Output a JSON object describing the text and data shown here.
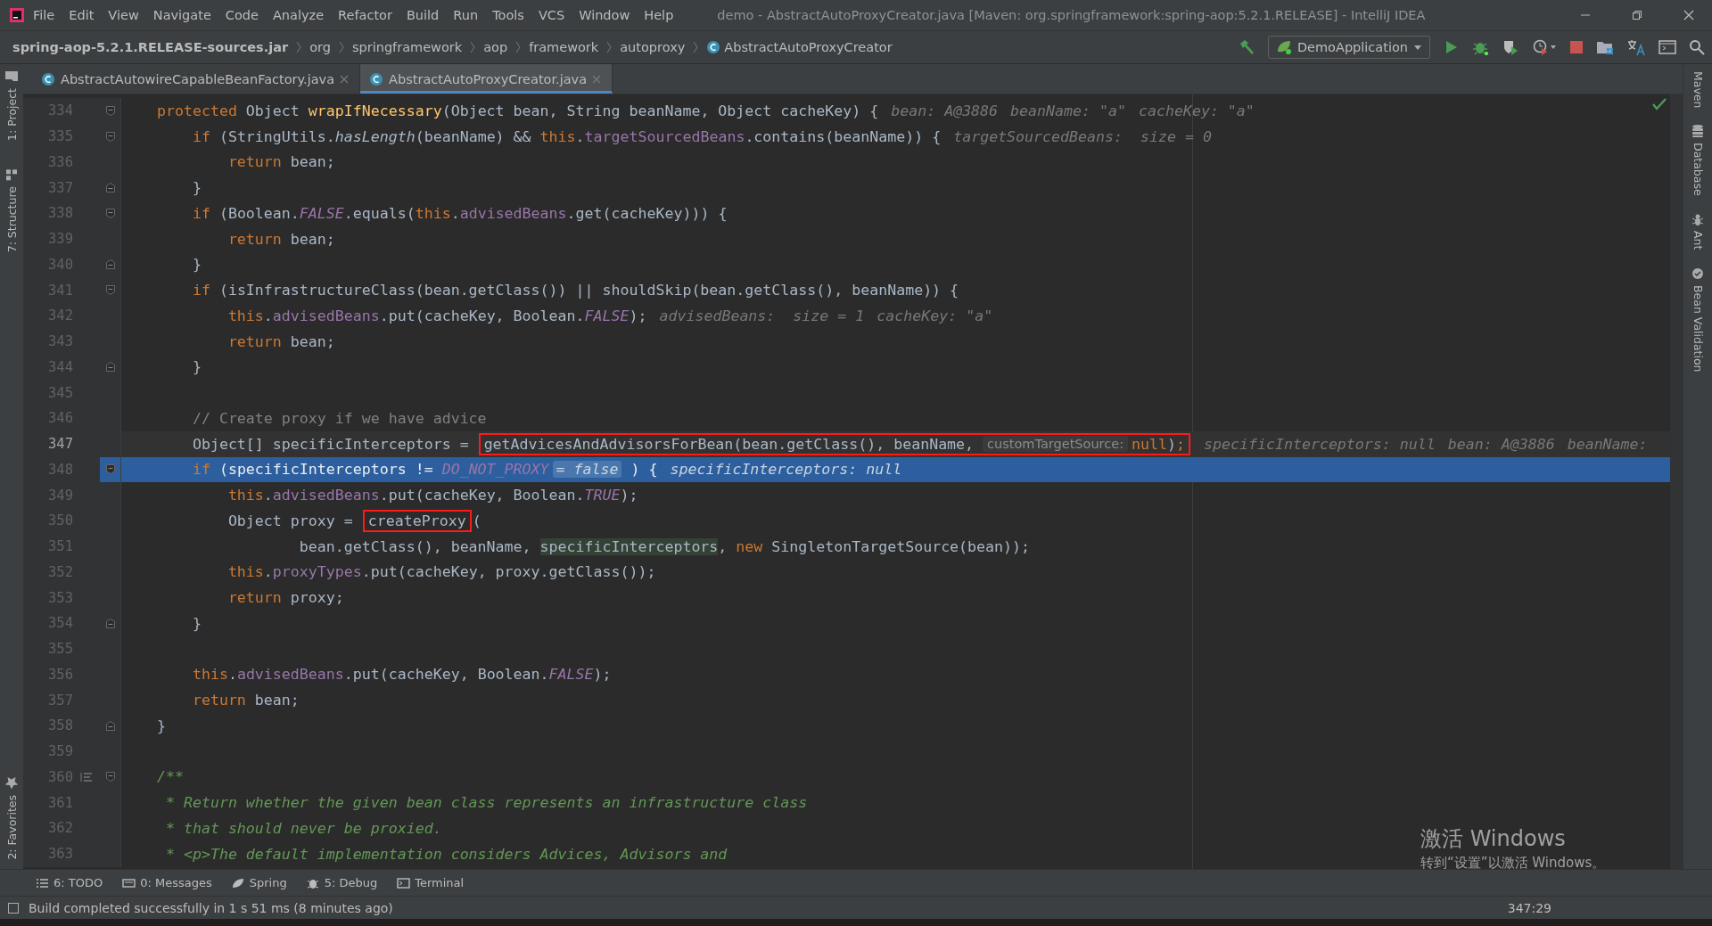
{
  "window": {
    "title": "demo - AbstractAutoProxyCreator.java [Maven: org.springframework:spring-aop:5.2.1.RELEASE] - IntelliJ IDEA"
  },
  "menu": [
    "File",
    "Edit",
    "View",
    "Navigate",
    "Code",
    "Analyze",
    "Refactor",
    "Build",
    "Run",
    "Tools",
    "VCS",
    "Window",
    "Help"
  ],
  "breadcrumbs": [
    {
      "label": "spring-aop-5.2.1.RELEASE-sources.jar",
      "kind": "jar"
    },
    {
      "label": "org",
      "kind": "package"
    },
    {
      "label": "springframework",
      "kind": "package"
    },
    {
      "label": "aop",
      "kind": "package"
    },
    {
      "label": "framework",
      "kind": "package"
    },
    {
      "label": "autoproxy",
      "kind": "package"
    },
    {
      "label": "AbstractAutoProxyCreator",
      "kind": "class"
    }
  ],
  "run_config": {
    "label": "DemoApplication"
  },
  "tabs": [
    {
      "label": "AbstractAutowireCapableBeanFactory.java",
      "selected": false
    },
    {
      "label": "AbstractAutoProxyCreator.java",
      "selected": true
    }
  ],
  "left_tools": [
    {
      "label": "1: Project",
      "kind": "folder"
    },
    {
      "label": "7: Structure",
      "kind": "structure"
    },
    {
      "label": "2: Favorites",
      "kind": "star"
    }
  ],
  "right_tools": [
    {
      "label": "Maven",
      "kind": "maven"
    },
    {
      "label": "Database",
      "kind": "database"
    },
    {
      "label": "Ant",
      "kind": "ant"
    },
    {
      "label": "Bean Validation",
      "kind": "bean"
    }
  ],
  "lines": [
    {
      "number": "334",
      "caret": false,
      "execution": false,
      "fold_start": true,
      "fold_end": false,
      "doc_toggle": false,
      "segments": [
        {
          "kind": "code",
          "parts": [
            {
              "kind": "keyword",
              "text": "    protected"
            },
            {
              "kind": "plain",
              "text": " Object "
            },
            {
              "kind": "decl",
              "text": "wrapIfNecessary"
            },
            {
              "kind": "plain",
              "text": "(Object bean, String beanName, Object cacheKey) {"
            }
          ]
        },
        {
          "kind": "hint",
          "text": "bean: A@3886"
        },
        {
          "kind": "hint",
          "text": "beanName: \"a\""
        },
        {
          "kind": "hint",
          "text": "cacheKey: \"a\""
        }
      ]
    },
    {
      "number": "335",
      "caret": false,
      "execution": false,
      "fold_start": true,
      "fold_end": false,
      "doc_toggle": false,
      "segments": [
        {
          "kind": "code",
          "parts": [
            {
              "kind": "keyword",
              "text": "        if"
            },
            {
              "kind": "plain",
              "text": " (StringUtils."
            },
            {
              "kind": "static-method",
              "text": "hasLength"
            },
            {
              "kind": "plain",
              "text": "(beanName) && "
            },
            {
              "kind": "keyword",
              "text": "this"
            },
            {
              "kind": "plain",
              "text": "."
            },
            {
              "kind": "field",
              "text": "targetSourcedBeans"
            },
            {
              "kind": "plain",
              "text": ".contains(beanName)) {"
            }
          ]
        },
        {
          "kind": "hint",
          "text": "targetSourcedBeans:  size = 0"
        }
      ]
    },
    {
      "number": "336",
      "caret": false,
      "execution": false,
      "fold_start": false,
      "fold_end": false,
      "doc_toggle": false,
      "segments": [
        {
          "kind": "code",
          "parts": [
            {
              "kind": "keyword",
              "text": "            return"
            },
            {
              "kind": "plain",
              "text": " bean;"
            }
          ]
        }
      ]
    },
    {
      "number": "337",
      "caret": false,
      "execution": false,
      "fold_start": false,
      "fold_end": true,
      "doc_toggle": false,
      "segments": [
        {
          "kind": "code",
          "parts": [
            {
              "kind": "plain",
              "text": "        }"
            }
          ]
        }
      ]
    },
    {
      "number": "338",
      "caret": false,
      "execution": false,
      "fold_start": true,
      "fold_end": false,
      "doc_toggle": false,
      "segments": [
        {
          "kind": "code",
          "parts": [
            {
              "kind": "keyword",
              "text": "        if"
            },
            {
              "kind": "plain",
              "text": " (Boolean."
            },
            {
              "kind": "static-field",
              "text": "FALSE"
            },
            {
              "kind": "plain",
              "text": ".equals("
            },
            {
              "kind": "keyword",
              "text": "this"
            },
            {
              "kind": "plain",
              "text": "."
            },
            {
              "kind": "field",
              "text": "advisedBeans"
            },
            {
              "kind": "plain",
              "text": ".get(cacheKey))) {"
            }
          ]
        }
      ]
    },
    {
      "number": "339",
      "caret": false,
      "execution": false,
      "fold_start": false,
      "fold_end": false,
      "doc_toggle": false,
      "segments": [
        {
          "kind": "code",
          "parts": [
            {
              "kind": "keyword",
              "text": "            return"
            },
            {
              "kind": "plain",
              "text": " bean;"
            }
          ]
        }
      ]
    },
    {
      "number": "340",
      "caret": false,
      "execution": false,
      "fold_start": false,
      "fold_end": true,
      "doc_toggle": false,
      "segments": [
        {
          "kind": "code",
          "parts": [
            {
              "kind": "plain",
              "text": "        }"
            }
          ]
        }
      ]
    },
    {
      "number": "341",
      "caret": false,
      "execution": false,
      "fold_start": true,
      "fold_end": false,
      "doc_toggle": false,
      "segments": [
        {
          "kind": "code",
          "parts": [
            {
              "kind": "keyword",
              "text": "        if"
            },
            {
              "kind": "plain",
              "text": " (isInfrastructureClass(bean.getClass()) || shouldSkip(bean.getClass(), beanName)) {"
            }
          ]
        }
      ]
    },
    {
      "number": "342",
      "caret": false,
      "execution": false,
      "fold_start": false,
      "fold_end": false,
      "doc_toggle": false,
      "segments": [
        {
          "kind": "code",
          "parts": [
            {
              "kind": "keyword",
              "text": "            this"
            },
            {
              "kind": "plain",
              "text": "."
            },
            {
              "kind": "field",
              "text": "advisedBeans"
            },
            {
              "kind": "plain",
              "text": ".put(cacheKey, Boolean."
            },
            {
              "kind": "static-field",
              "text": "FALSE"
            },
            {
              "kind": "plain",
              "text": ");"
            }
          ]
        },
        {
          "kind": "hint",
          "text": "advisedBeans:  size = 1"
        },
        {
          "kind": "hint",
          "text": "cacheKey: \"a\""
        }
      ]
    },
    {
      "number": "343",
      "caret": false,
      "execution": false,
      "fold_start": false,
      "fold_end": false,
      "doc_toggle": false,
      "segments": [
        {
          "kind": "code",
          "parts": [
            {
              "kind": "keyword",
              "text": "            return"
            },
            {
              "kind": "plain",
              "text": " bean;"
            }
          ]
        }
      ]
    },
    {
      "number": "344",
      "caret": false,
      "execution": false,
      "fold_start": false,
      "fold_end": true,
      "doc_toggle": false,
      "segments": [
        {
          "kind": "code",
          "parts": [
            {
              "kind": "plain",
              "text": "        }"
            }
          ]
        }
      ]
    },
    {
      "number": "345",
      "caret": false,
      "execution": false,
      "fold_start": false,
      "fold_end": false,
      "doc_toggle": false
    },
    {
      "number": "346",
      "caret": false,
      "execution": false,
      "fold_start": false,
      "fold_end": false,
      "doc_toggle": false,
      "segments": [
        {
          "kind": "code",
          "parts": [
            {
              "kind": "comment",
              "text": "        // Create proxy if we have advice"
            }
          ]
        }
      ]
    },
    {
      "number": "347",
      "caret": true,
      "execution": false,
      "fold_start": false,
      "fold_end": false,
      "doc_toggle": false,
      "segments": [
        {
          "kind": "code",
          "parts": [
            {
              "kind": "plain",
              "text": "        Object[] specificInterceptors = "
            }
          ]
        },
        {
          "kind": "boxed",
          "segments": [
            {
              "kind": "code",
              "parts": [
                {
                  "kind": "plain",
                  "text": "getAdvicesAndAdvisorsForBean(bean.getClass(), beanName, "
                }
              ]
            },
            {
              "kind": "param-hint",
              "text": "customTargetSource:"
            },
            {
              "kind": "code",
              "parts": [
                {
                  "kind": "keyword",
                  "text": "null"
                },
                {
                  "kind": "plain",
                  "text": ")"
                },
                {
                  "kind": "keyword",
                  "text": ";"
                }
              ]
            }
          ]
        },
        {
          "kind": "hint",
          "text": "specificInterceptors: null"
        },
        {
          "kind": "hint",
          "text": "bean: A@3886"
        },
        {
          "kind": "hint",
          "text": "beanName:"
        }
      ]
    },
    {
      "number": "348",
      "caret": false,
      "execution": true,
      "fold_start": true,
      "fold_end": false,
      "doc_toggle": false,
      "segments": [
        {
          "kind": "code",
          "parts": [
            {
              "kind": "keyword",
              "text": "        if"
            },
            {
              "kind": "plain",
              "text": " (specificInterceptors != "
            },
            {
              "kind": "static-field",
              "text": "DO_NOT_PROXY"
            }
          ]
        },
        {
          "kind": "value-hint",
          "text": "= false"
        },
        {
          "kind": "code",
          "parts": [
            {
              "kind": "plain",
              "text": " ) {"
            }
          ]
        },
        {
          "kind": "hint",
          "text": "specificInterceptors: null"
        }
      ]
    },
    {
      "number": "349",
      "caret": false,
      "execution": false,
      "fold_start": false,
      "fold_end": false,
      "doc_toggle": false,
      "segments": [
        {
          "kind": "code",
          "parts": [
            {
              "kind": "keyword",
              "text": "            this"
            },
            {
              "kind": "plain",
              "text": "."
            },
            {
              "kind": "field",
              "text": "advisedBeans"
            },
            {
              "kind": "plain",
              "text": ".put(cacheKey, Boolean."
            },
            {
              "kind": "static-field",
              "text": "TRUE"
            },
            {
              "kind": "plain",
              "text": ");"
            }
          ]
        }
      ]
    },
    {
      "number": "350",
      "caret": false,
      "execution": false,
      "fold_start": false,
      "fold_end": false,
      "doc_toggle": false,
      "segments": [
        {
          "kind": "code",
          "parts": [
            {
              "kind": "plain",
              "text": "            Object proxy = "
            }
          ]
        },
        {
          "kind": "boxed",
          "segments": [
            {
              "kind": "code",
              "parts": [
                {
                  "kind": "plain",
                  "text": "createProxy"
                }
              ]
            }
          ]
        },
        {
          "kind": "code",
          "parts": [
            {
              "kind": "plain",
              "text": "("
            }
          ]
        }
      ]
    },
    {
      "number": "351",
      "caret": false,
      "execution": false,
      "fold_start": false,
      "fold_end": false,
      "doc_toggle": false,
      "segments": [
        {
          "kind": "code",
          "parts": [
            {
              "kind": "plain",
              "text": "                    bean.getClass(), beanName, "
            },
            {
              "kind": "usage",
              "text": "specificInterceptors"
            },
            {
              "kind": "plain",
              "text": ", "
            },
            {
              "kind": "keyword",
              "text": "new"
            },
            {
              "kind": "plain",
              "text": " SingletonTargetSource(bean));"
            }
          ]
        }
      ]
    },
    {
      "number": "352",
      "caret": false,
      "execution": false,
      "fold_start": false,
      "fold_end": false,
      "doc_toggle": false,
      "segments": [
        {
          "kind": "code",
          "parts": [
            {
              "kind": "keyword",
              "text": "            this"
            },
            {
              "kind": "plain",
              "text": "."
            },
            {
              "kind": "field",
              "text": "proxyTypes"
            },
            {
              "kind": "plain",
              "text": ".put(cacheKey, proxy.getClass());"
            }
          ]
        }
      ]
    },
    {
      "number": "353",
      "caret": false,
      "execution": false,
      "fold_start": false,
      "fold_end": false,
      "doc_toggle": false,
      "segments": [
        {
          "kind": "code",
          "parts": [
            {
              "kind": "keyword",
              "text": "            return"
            },
            {
              "kind": "plain",
              "text": " proxy;"
            }
          ]
        }
      ]
    },
    {
      "number": "354",
      "caret": false,
      "execution": false,
      "fold_start": false,
      "fold_end": true,
      "doc_toggle": false,
      "segments": [
        {
          "kind": "code",
          "parts": [
            {
              "kind": "plain",
              "text": "        }"
            }
          ]
        }
      ]
    },
    {
      "number": "355",
      "caret": false,
      "execution": false,
      "fold_start": false,
      "fold_end": false,
      "doc_toggle": false
    },
    {
      "number": "356",
      "caret": false,
      "execution": false,
      "fold_start": false,
      "fold_end": false,
      "doc_toggle": false,
      "segments": [
        {
          "kind": "code",
          "parts": [
            {
              "kind": "keyword",
              "text": "        this"
            },
            {
              "kind": "plain",
              "text": "."
            },
            {
              "kind": "field",
              "text": "advisedBeans"
            },
            {
              "kind": "plain",
              "text": ".put(cacheKey, Boolean."
            },
            {
              "kind": "static-field",
              "text": "FALSE"
            },
            {
              "kind": "plain",
              "text": ");"
            }
          ]
        }
      ]
    },
    {
      "number": "357",
      "caret": false,
      "execution": false,
      "fold_start": false,
      "fold_end": false,
      "doc_toggle": false,
      "segments": [
        {
          "kind": "code",
          "parts": [
            {
              "kind": "keyword",
              "text": "        return"
            },
            {
              "kind": "plain",
              "text": " bean;"
            }
          ]
        }
      ]
    },
    {
      "number": "358",
      "caret": false,
      "execution": false,
      "fold_start": false,
      "fold_end": true,
      "doc_toggle": false,
      "segments": [
        {
          "kind": "code",
          "parts": [
            {
              "kind": "plain",
              "text": "    }"
            }
          ]
        }
      ]
    },
    {
      "number": "359",
      "caret": false,
      "execution": false,
      "fold_start": false,
      "fold_end": false,
      "doc_toggle": false
    },
    {
      "number": "360",
      "caret": false,
      "execution": false,
      "fold_start": true,
      "fold_end": false,
      "doc_toggle": true,
      "segments": [
        {
          "kind": "code",
          "parts": [
            {
              "kind": "doc",
              "text": "    /**"
            }
          ]
        }
      ]
    },
    {
      "number": "361",
      "caret": false,
      "execution": false,
      "fold_start": false,
      "fold_end": false,
      "doc_toggle": false,
      "segments": [
        {
          "kind": "code",
          "parts": [
            {
              "kind": "doc",
              "text": "     * Return whether the given bean class represents an infrastructure class"
            }
          ]
        }
      ]
    },
    {
      "number": "362",
      "caret": false,
      "execution": false,
      "fold_start": false,
      "fold_end": false,
      "doc_toggle": false,
      "segments": [
        {
          "kind": "code",
          "parts": [
            {
              "kind": "doc",
              "text": "     * that should never be proxied."
            }
          ]
        }
      ]
    },
    {
      "number": "363",
      "caret": false,
      "execution": false,
      "fold_start": false,
      "fold_end": false,
      "doc_toggle": false,
      "segments": [
        {
          "kind": "code",
          "parts": [
            {
              "kind": "doc",
              "text": "     * <p>The default implementation considers Advices, Advisors and"
            }
          ]
        }
      ]
    }
  ],
  "bottom_tools": [
    {
      "label": "6: TODO",
      "kind": "list"
    },
    {
      "label": "0: Messages",
      "kind": "messages"
    },
    {
      "label": "Spring",
      "kind": "spring"
    },
    {
      "label": "5: Debug",
      "kind": "debug"
    },
    {
      "label": "Terminal",
      "kind": "terminal"
    }
  ],
  "status_bar": {
    "message": "Build completed successfully in 1 s 51 ms (8 minutes ago)",
    "position": "347:29"
  },
  "os_overlay": {
    "title": "激活 Windows",
    "subtitle": "转到“设置”以激活 Windows。"
  }
}
